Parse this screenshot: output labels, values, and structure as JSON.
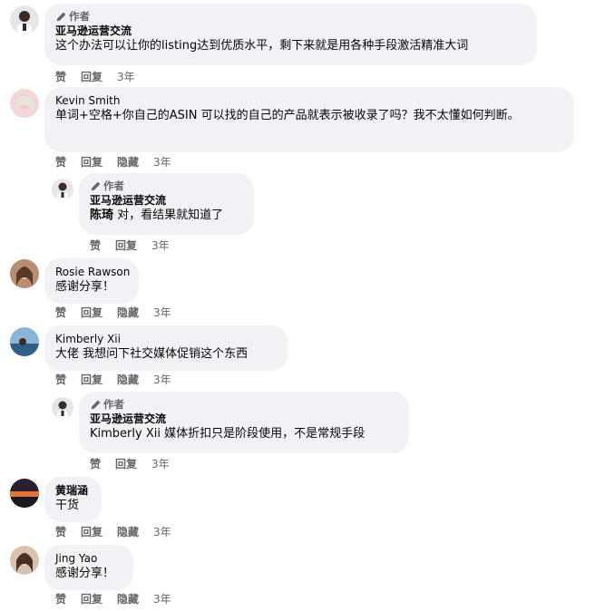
{
  "author_badge": "作者",
  "actions": {
    "like": "赞",
    "reply": "回复",
    "hide": "隐藏"
  },
  "comments": [
    {
      "name": "亚马逊运营交流",
      "text": "这个办法可以让你的listing达到优质水平，剩下来就是用各种手段激活精准大词",
      "time": "3年"
    },
    {
      "name": "Kevin Smith",
      "text": "单词+空格+你自己的ASIN 可以找的自己的产品就表示被收录了吗？我不太懂如何判断。",
      "time": "3年"
    },
    {
      "name": "亚马逊运营交流",
      "mention": "陈琦",
      "text": " 对，看结果就知道了",
      "time": "3年"
    },
    {
      "name": "Rosie Rawson",
      "text": "感谢分享！",
      "time": "3年"
    },
    {
      "name": "Kimberly Xii",
      "text": "大佬 我想问下社交媒体促销这个东西",
      "time": "3年"
    },
    {
      "name": "亚马逊运营交流",
      "mention": "Kimberly Xii",
      "text": " 媒体折扣只是阶段使用，不是常规手段",
      "time": "3年"
    },
    {
      "name": "黄瑞涵",
      "text": "干货",
      "time": "3年"
    },
    {
      "name": "Jing Yao",
      "text": "感谢分享！",
      "time": "3年"
    }
  ],
  "colors": {
    "bubble": "#f0f2f5",
    "meta": "#65676b",
    "text": "#050505"
  }
}
